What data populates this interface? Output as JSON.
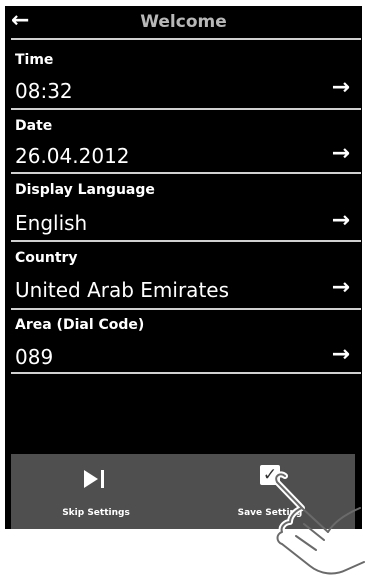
{
  "header": {
    "back_icon": "arrow-left-icon",
    "title": "Welcome"
  },
  "settings": [
    {
      "label": "Time",
      "value": "08:32"
    },
    {
      "label": "Date",
      "value": "26.04.2012"
    },
    {
      "label": "Display Language",
      "value": "English"
    },
    {
      "label": "Country",
      "value": "United Arab Emirates"
    },
    {
      "label": "Area (Dial Code)",
      "value": "089"
    }
  ],
  "bottom_bar": {
    "skip_label": "Skip Settings",
    "skip_icon": "skip-forward-icon",
    "save_label": "Save Setting",
    "save_icon": "checkmark-icon"
  }
}
